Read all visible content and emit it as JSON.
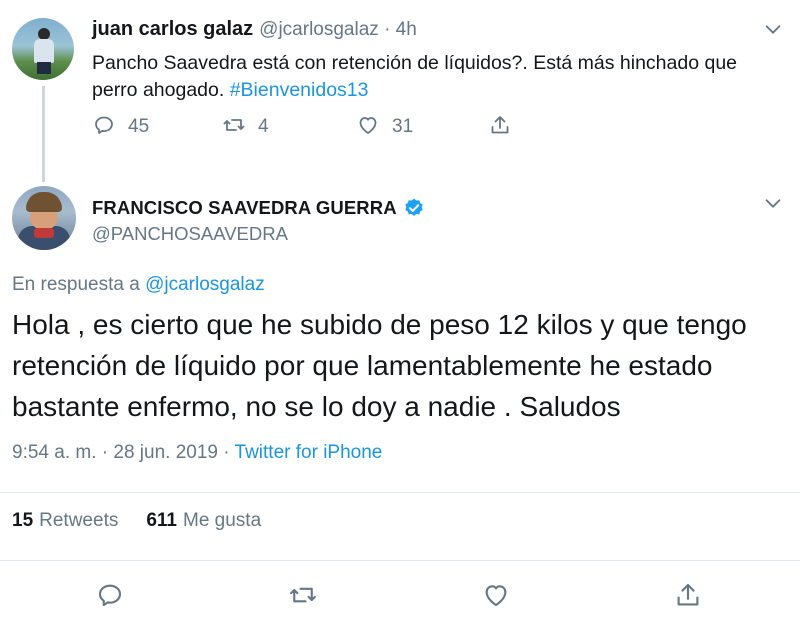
{
  "parent_tweet": {
    "display_name": "juan carlos galaz",
    "handle_time": "@jcarlosgalaz · 4h",
    "text": "Pancho Saavedra está con retención de líquidos?. Está más hinchado que perro ahogado. ",
    "hashtag": "#Bienvenidos13",
    "reply_count": "45",
    "retweet_count": "4",
    "like_count": "31"
  },
  "main_tweet": {
    "display_name": "FRANCISCO SAAVEDRA GUERRA",
    "handle": "@PANCHOSAAVEDRA",
    "reply_prefix": "En respuesta a ",
    "reply_mention": "@jcarlosgalaz",
    "text": "Hola , es cierto que he subido de peso 12 kilos y que tengo retención de líquido por que lamentablemente he estado bastante enfermo, no se lo doy a nadie . Saludos",
    "timestamp": "9:54 a. m. · 28 jun. 2019 · ",
    "source": "Twitter for iPhone",
    "retweets_count": "15",
    "retweets_label": "Retweets",
    "likes_count": "611",
    "likes_label": "Me gusta"
  },
  "icons": {
    "reply": "reply-icon",
    "retweet": "retweet-icon",
    "like": "heart-icon",
    "share": "share-icon",
    "verified": "verified-badge-icon",
    "menu": "chevron-down-icon"
  },
  "colors": {
    "link": "#1b95e0",
    "secondary_text": "#657786",
    "primary_text": "#14171a",
    "divider": "#e1e8ed"
  }
}
